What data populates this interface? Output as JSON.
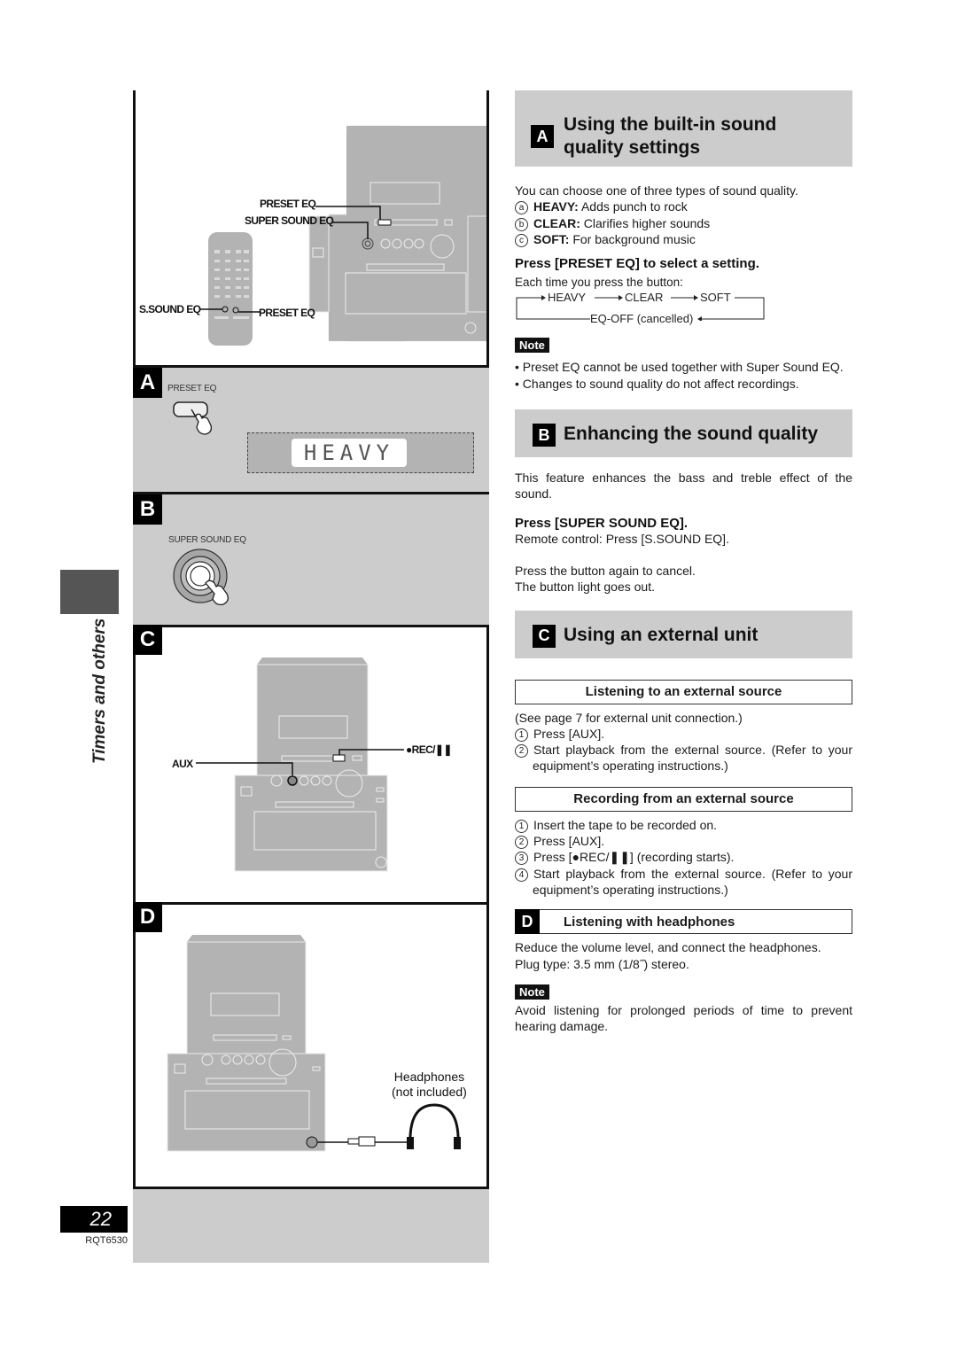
{
  "side_tab": {
    "label": "Timers and others"
  },
  "footer": {
    "page_number": "22",
    "model_code": "RQT6530"
  },
  "illustrations": {
    "top": {
      "unit_callouts": [
        "PRESET EQ",
        "SUPER SOUND EQ"
      ],
      "remote_callouts": {
        "left": "S.SOUND EQ",
        "right": "PRESET EQ"
      }
    },
    "a": {
      "tag": "A",
      "button_label": "PRESET EQ",
      "display_text": "HEAVY"
    },
    "b": {
      "tag": "B",
      "button_label": "SUPER SOUND EQ"
    },
    "c": {
      "tag": "C",
      "callout_aux": "AUX",
      "callout_rec": "●REC/❚❚"
    },
    "d": {
      "tag": "D",
      "headphones_label_1": "Headphones",
      "headphones_label_2": "(not included)"
    }
  },
  "sections": {
    "a": {
      "tag": "A",
      "title_line1": "Using the built-in sound",
      "title_line2": "quality settings",
      "intro": "You can choose one of three types of sound quality.",
      "options": [
        {
          "marker": "a",
          "name": "HEAVY:",
          "desc": " Adds punch to rock"
        },
        {
          "marker": "b",
          "name": "CLEAR:",
          "desc": " Clarifies higher sounds"
        },
        {
          "marker": "c",
          "name": "SOFT:",
          "desc": " For background music"
        }
      ],
      "instruction": "Press [PRESET EQ] to select a setting.",
      "each_time": "Each time you press the button:",
      "cycle": [
        "HEAVY",
        "CLEAR",
        "SOFT",
        "EQ-OFF (cancelled)"
      ],
      "note_label": "Note",
      "notes": [
        "Preset EQ cannot be used together with Super Sound EQ.",
        "Changes to sound quality do not affect recordings."
      ]
    },
    "b": {
      "tag": "B",
      "title": "Enhancing the sound quality",
      "intro": "This feature enhances the bass and treble effect of the sound.",
      "instruction": "Press [SUPER SOUND EQ].",
      "remote": "Remote control: Press [S.SOUND EQ].",
      "cancel_1": "Press the button again to cancel.",
      "cancel_2": "The button light goes out."
    },
    "c": {
      "tag": "C",
      "title": "Using an external unit",
      "listening": {
        "heading": "Listening to an external source",
        "see_page": "(See page 7 for external unit connection.)",
        "steps": [
          {
            "marker": "1",
            "text": "Press [AUX]."
          },
          {
            "marker": "2",
            "text": "Start playback from the external source.  (Refer to your equipment’s operating instructions.)"
          }
        ]
      },
      "recording": {
        "heading": "Recording from an external source",
        "steps": [
          {
            "marker": "1",
            "text": "Insert the tape to be recorded on."
          },
          {
            "marker": "2",
            "text": "Press [AUX]."
          },
          {
            "marker": "3",
            "text": "Press [●REC/❚❚] (recording starts)."
          },
          {
            "marker": "4",
            "text": "Start playback from the external source. (Refer to your equipment’s operating instructions.)"
          }
        ]
      }
    },
    "d": {
      "tag": "D",
      "heading": "Listening with headphones",
      "text_1": "Reduce the volume level, and connect the headphones.",
      "text_2": "Plug type: 3.5 mm (1/8˝) stereo.",
      "note_label": "Note",
      "note": "Avoid listening for prolonged periods of time to prevent hearing damage."
    }
  }
}
